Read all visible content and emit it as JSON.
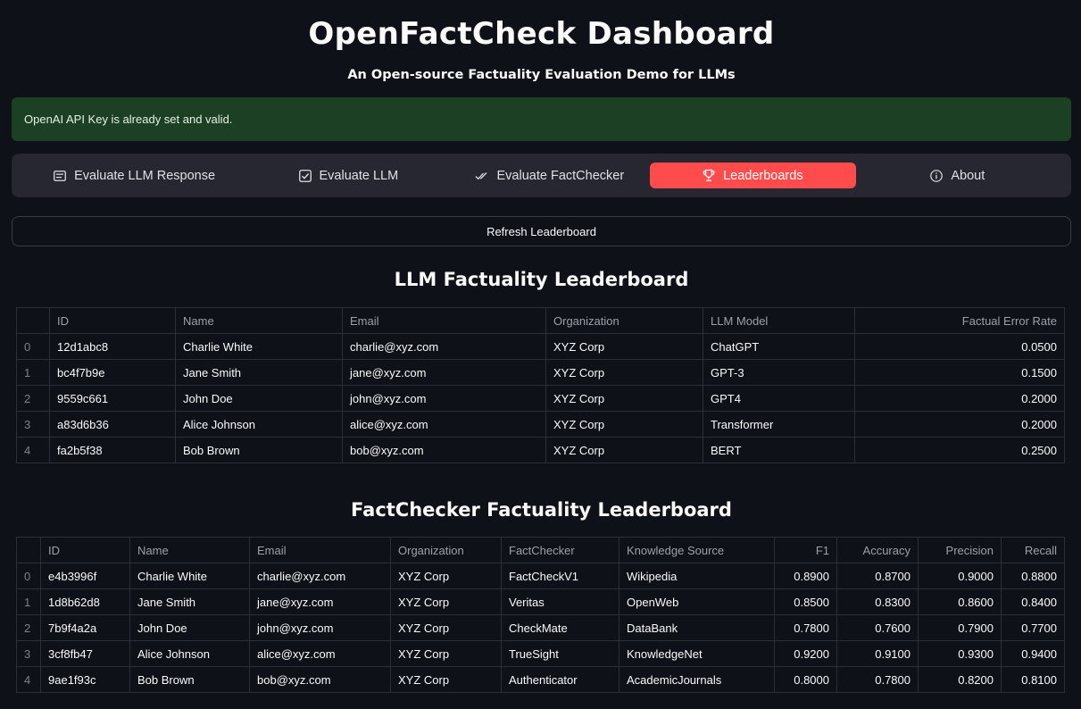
{
  "header": {
    "title": "OpenFactCheck Dashboard",
    "subtitle": "An Open-source Factuality Evaluation Demo for LLMs"
  },
  "alert": {
    "text": "OpenAI API Key is already set and valid.",
    "color": "#1c4024"
  },
  "nav": {
    "items": [
      {
        "label": "Evaluate LLM Response",
        "icon": "card-icon"
      },
      {
        "label": "Evaluate LLM",
        "icon": "checkbox-icon"
      },
      {
        "label": "Evaluate FactChecker",
        "icon": "double-check-icon"
      },
      {
        "label": "Leaderboards",
        "icon": "trophy-icon",
        "active": true
      },
      {
        "label": "About",
        "icon": "info-icon"
      }
    ],
    "accent": "#ff4b4b"
  },
  "refresh_button": {
    "label": "Refresh Leaderboard"
  },
  "llm_leaderboard": {
    "title": "LLM Factuality Leaderboard",
    "columns": [
      "",
      "ID",
      "Name",
      "Email",
      "Organization",
      "LLM Model",
      "Factual Error Rate"
    ],
    "rows": [
      [
        "0",
        "12d1abc8",
        "Charlie White",
        "charlie@xyz.com",
        "XYZ Corp",
        "ChatGPT",
        "0.0500"
      ],
      [
        "1",
        "bc4f7b9e",
        "Jane Smith",
        "jane@xyz.com",
        "XYZ Corp",
        "GPT-3",
        "0.1500"
      ],
      [
        "2",
        "9559c661",
        "John Doe",
        "john@xyz.com",
        "XYZ Corp",
        "GPT4",
        "0.2000"
      ],
      [
        "3",
        "a83d6b36",
        "Alice Johnson",
        "alice@xyz.com",
        "XYZ Corp",
        "Transformer",
        "0.2000"
      ],
      [
        "4",
        "fa2b5f38",
        "Bob Brown",
        "bob@xyz.com",
        "XYZ Corp",
        "BERT",
        "0.2500"
      ]
    ]
  },
  "factchecker_leaderboard": {
    "title": "FactChecker Factuality Leaderboard",
    "columns": [
      "",
      "ID",
      "Name",
      "Email",
      "Organization",
      "FactChecker",
      "Knowledge Source",
      "F1",
      "Accuracy",
      "Precision",
      "Recall"
    ],
    "rows": [
      [
        "0",
        "e4b3996f",
        "Charlie White",
        "charlie@xyz.com",
        "XYZ Corp",
        "FactCheckV1",
        "Wikipedia",
        "0.8900",
        "0.8700",
        "0.9000",
        "0.8800"
      ],
      [
        "1",
        "1d8b62d8",
        "Jane Smith",
        "jane@xyz.com",
        "XYZ Corp",
        "Veritas",
        "OpenWeb",
        "0.8500",
        "0.8300",
        "0.8600",
        "0.8400"
      ],
      [
        "2",
        "7b9f4a2a",
        "John Doe",
        "john@xyz.com",
        "XYZ Corp",
        "CheckMate",
        "DataBank",
        "0.7800",
        "0.7600",
        "0.7900",
        "0.7700"
      ],
      [
        "3",
        "3cf8fb47",
        "Alice Johnson",
        "alice@xyz.com",
        "XYZ Corp",
        "TrueSight",
        "KnowledgeNet",
        "0.9200",
        "0.9100",
        "0.9300",
        "0.9400"
      ],
      [
        "4",
        "9ae1f93c",
        "Bob Brown",
        "bob@xyz.com",
        "XYZ Corp",
        "Authenticator",
        "AcademicJournals",
        "0.8000",
        "0.7800",
        "0.8200",
        "0.8100"
      ]
    ]
  }
}
